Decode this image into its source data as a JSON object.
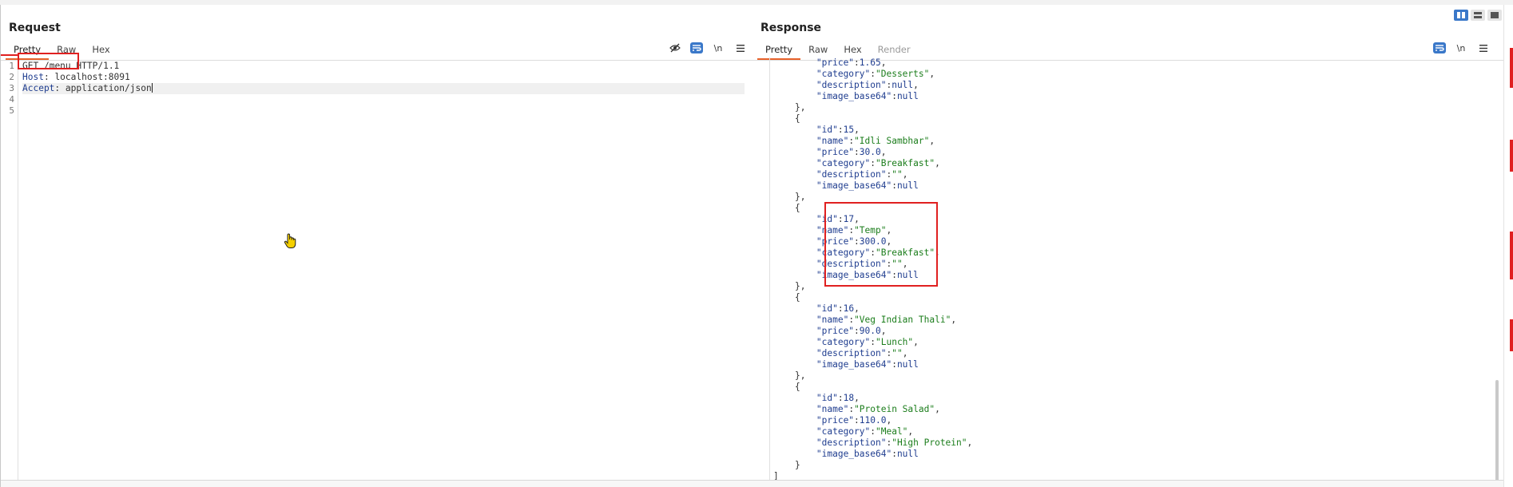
{
  "request": {
    "title": "Request",
    "tabs": [
      "Pretty",
      "Raw",
      "Hex"
    ],
    "active_tab": "Pretty",
    "tools": {
      "hide_icon": "eye-slash-icon",
      "wrap_icon": "wrap-lines-icon",
      "newline_label": "\\n",
      "menu_icon": "hamburger-menu-icon"
    },
    "line_numbers": [
      "1",
      "2",
      "3",
      "4",
      "5"
    ],
    "lines": {
      "l1_method": "GET",
      "l1_path": "/menu",
      "l1_proto": "HTTP/1.1",
      "l2_key": "Host",
      "l2_value": "localhost:8091",
      "l3_key": "Accept",
      "l3_value": "application/json"
    }
  },
  "response": {
    "title": "Response",
    "tabs": [
      "Pretty",
      "Raw",
      "Hex",
      "Render"
    ],
    "active_tab": "Pretty",
    "tools": {
      "wrap_icon": "wrap-lines-icon",
      "newline_label": "\\n",
      "menu_icon": "hamburger-menu-icon"
    },
    "lines": [
      {
        "indent": 8,
        "key": "\"price\"",
        "val": "1.65",
        "type": "n",
        "tail": ","
      },
      {
        "indent": 8,
        "key": "\"category\"",
        "val": "\"Desserts\"",
        "type": "s",
        "tail": ","
      },
      {
        "indent": 8,
        "key": "\"description\"",
        "val": "null",
        "type": "n",
        "tail": ","
      },
      {
        "indent": 8,
        "key": "\"image_base64\"",
        "val": "null",
        "type": "n",
        "tail": ""
      },
      {
        "indent": 4,
        "punct": "},"
      },
      {
        "indent": 4,
        "punct": "{"
      },
      {
        "indent": 8,
        "key": "\"id\"",
        "val": "15",
        "type": "n",
        "tail": ","
      },
      {
        "indent": 8,
        "key": "\"name\"",
        "val": "\"Idli Sambhar\"",
        "type": "s",
        "tail": ","
      },
      {
        "indent": 8,
        "key": "\"price\"",
        "val": "30.0",
        "type": "n",
        "tail": ","
      },
      {
        "indent": 8,
        "key": "\"category\"",
        "val": "\"Breakfast\"",
        "type": "s",
        "tail": ","
      },
      {
        "indent": 8,
        "key": "\"description\"",
        "val": "\"\"",
        "type": "s",
        "tail": ","
      },
      {
        "indent": 8,
        "key": "\"image_base64\"",
        "val": "null",
        "type": "n",
        "tail": ""
      },
      {
        "indent": 4,
        "punct": "},"
      },
      {
        "indent": 4,
        "punct": "{"
      },
      {
        "indent": 8,
        "key": "\"id\"",
        "val": "17",
        "type": "n",
        "tail": ","
      },
      {
        "indent": 8,
        "key": "\"name\"",
        "val": "\"Temp\"",
        "type": "s",
        "tail": ","
      },
      {
        "indent": 8,
        "key": "\"price\"",
        "val": "300.0",
        "type": "n",
        "tail": ","
      },
      {
        "indent": 8,
        "key": "\"category\"",
        "val": "\"Breakfast\"",
        "type": "s",
        "tail": ","
      },
      {
        "indent": 8,
        "key": "\"description\"",
        "val": "\"\"",
        "type": "s",
        "tail": ","
      },
      {
        "indent": 8,
        "key": "\"image_base64\"",
        "val": "null",
        "type": "n",
        "tail": ""
      },
      {
        "indent": 4,
        "punct": "},"
      },
      {
        "indent": 4,
        "punct": "{"
      },
      {
        "indent": 8,
        "key": "\"id\"",
        "val": "16",
        "type": "n",
        "tail": ","
      },
      {
        "indent": 8,
        "key": "\"name\"",
        "val": "\"Veg Indian Thali\"",
        "type": "s",
        "tail": ","
      },
      {
        "indent": 8,
        "key": "\"price\"",
        "val": "90.0",
        "type": "n",
        "tail": ","
      },
      {
        "indent": 8,
        "key": "\"category\"",
        "val": "\"Lunch\"",
        "type": "s",
        "tail": ","
      },
      {
        "indent": 8,
        "key": "\"description\"",
        "val": "\"\"",
        "type": "s",
        "tail": ","
      },
      {
        "indent": 8,
        "key": "\"image_base64\"",
        "val": "null",
        "type": "n",
        "tail": ""
      },
      {
        "indent": 4,
        "punct": "},"
      },
      {
        "indent": 4,
        "punct": "{"
      },
      {
        "indent": 8,
        "key": "\"id\"",
        "val": "18",
        "type": "n",
        "tail": ","
      },
      {
        "indent": 8,
        "key": "\"name\"",
        "val": "\"Protein Salad\"",
        "type": "s",
        "tail": ","
      },
      {
        "indent": 8,
        "key": "\"price\"",
        "val": "110.0",
        "type": "n",
        "tail": ","
      },
      {
        "indent": 8,
        "key": "\"category\"",
        "val": "\"Meal\"",
        "type": "s",
        "tail": ","
      },
      {
        "indent": 8,
        "key": "\"description\"",
        "val": "\"High Protein\"",
        "type": "s",
        "tail": ","
      },
      {
        "indent": 8,
        "key": "\"image_base64\"",
        "val": "null",
        "type": "n",
        "tail": ""
      },
      {
        "indent": 4,
        "punct": "}"
      },
      {
        "indent": 0,
        "punct": "]"
      }
    ]
  },
  "layout_buttons": [
    "split-horizontal-icon",
    "split-vertical-icon",
    "single-pane-icon"
  ],
  "colors": {
    "accent": "#e8622b",
    "toggle_blue": "#3a78c9",
    "highlight_red": "#e02020",
    "string_green": "#1b7d1b",
    "key_blue": "#1f3d8f"
  }
}
